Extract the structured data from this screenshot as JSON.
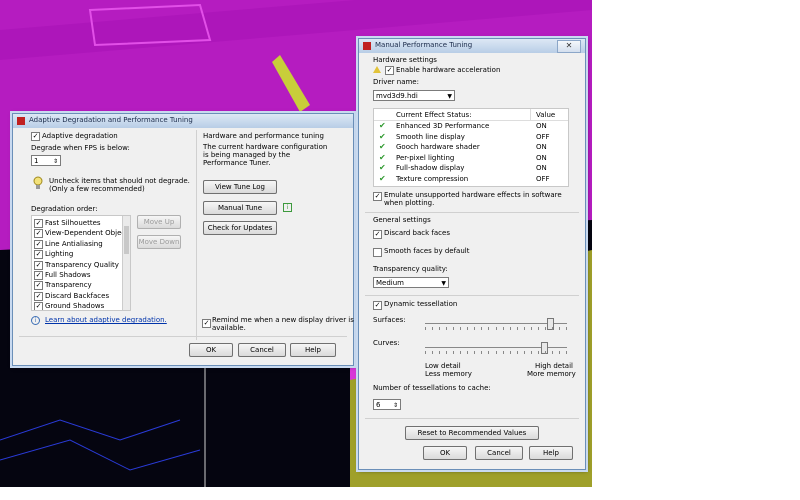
{
  "left_dialog": {
    "title": "Adaptive Degradation and Performance Tuning",
    "adaptive_label": "Adaptive degradation",
    "adaptive_checked": true,
    "fps_label": "Degrade when FPS is below:",
    "fps_value": "1",
    "tip_line1": "Uncheck items that should not degrade.",
    "tip_line2": "(Only a few recommended)",
    "order_label": "Degradation order:",
    "order_items": [
      {
        "label": "Fast Silhouettes",
        "checked": true
      },
      {
        "label": "View-Dependent Objects",
        "checked": true
      },
      {
        "label": "Line Antialiasing",
        "checked": true
      },
      {
        "label": "Lighting",
        "checked": true
      },
      {
        "label": "Transparency Quality",
        "checked": true
      },
      {
        "label": "Full Shadows",
        "checked": true
      },
      {
        "label": "Transparency",
        "checked": true
      },
      {
        "label": "Discard Backfaces",
        "checked": true
      },
      {
        "label": "Ground Shadows",
        "checked": true
      }
    ],
    "move_up": "Move Up",
    "move_down": "Move Down",
    "learn_link": "Learn about adaptive degradation.",
    "hw_title": "Hardware and performance tuning",
    "hw_desc1": "The current hardware configuration",
    "hw_desc2": "is being managed by the",
    "hw_desc3": "Performance Tuner.",
    "view_log": "View Tune Log",
    "manual_tune": "Manual Tune",
    "check_updates": "Check for Updates",
    "remind_line1": "Remind me when a new display driver is",
    "remind_line2": "available.",
    "remind_checked": true,
    "ok": "OK",
    "cancel": "Cancel",
    "help": "Help"
  },
  "right_dialog": {
    "title": "Manual Performance Tuning",
    "hw_settings": "Hardware settings",
    "enable_hw": "Enable hardware acceleration",
    "enable_hw_checked": true,
    "driver_label": "Driver name:",
    "driver_value": "mvd3d9.hdi",
    "col_effect": "Current Effect Status:",
    "col_value": "Value",
    "effects": [
      {
        "name": "Enhanced 3D Performance",
        "value": "ON"
      },
      {
        "name": "Smooth line display",
        "value": "OFF"
      },
      {
        "name": "Gooch hardware shader",
        "value": "ON"
      },
      {
        "name": "Per-pixel lighting",
        "value": "ON"
      },
      {
        "name": "Full-shadow display",
        "value": "ON"
      },
      {
        "name": "Texture compression",
        "value": "OFF"
      }
    ],
    "emulate_line1": "Emulate unsupported hardware effects in software",
    "emulate_line2": "when plotting.",
    "emulate_checked": true,
    "general": "General settings",
    "discard": "Discard back faces",
    "discard_checked": true,
    "smooth": "Smooth faces by default",
    "smooth_checked": false,
    "transp_label": "Transparency quality:",
    "transp_value": "Medium",
    "dyn_tess": "Dynamic tessellation",
    "dyn_tess_checked": true,
    "surfaces": "Surfaces:",
    "surfaces_level": 0.9,
    "curves": "Curves:",
    "curves_level": 0.85,
    "low_detail": "Low detail",
    "less_memory": "Less memory",
    "high_detail": "High detail",
    "more_memory": "More memory",
    "num_tess_label": "Number of tessellations to cache:",
    "num_tess_value": "6",
    "reset": "Reset to Recommended Values",
    "ok": "OK",
    "cancel": "Cancel",
    "help": "Help"
  },
  "colors": {
    "background_magenta": "#b51cc0",
    "yellow_geometry": "#c6c33a",
    "dark_area": "#050510",
    "check_green": "#2f9a2f"
  }
}
